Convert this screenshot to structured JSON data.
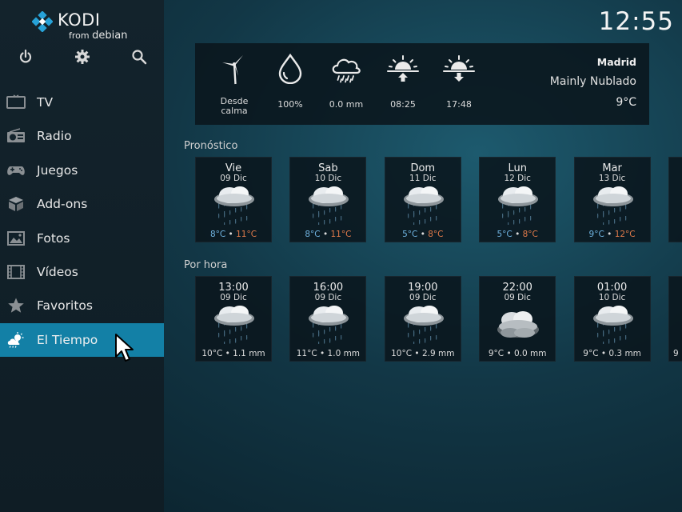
{
  "app": {
    "logo_text": "KODI",
    "logo_from": "from",
    "logo_distro": "debian"
  },
  "top_icons": [
    {
      "name": "power-icon"
    },
    {
      "name": "gear-icon"
    },
    {
      "name": "search-icon"
    }
  ],
  "sidebar": {
    "items": [
      {
        "label": "TV",
        "icon": "tv-icon"
      },
      {
        "label": "Radio",
        "icon": "radio-icon"
      },
      {
        "label": "Juegos",
        "icon": "gamepad-icon"
      },
      {
        "label": "Add-ons",
        "icon": "box-icon"
      },
      {
        "label": "Fotos",
        "icon": "photo-icon"
      },
      {
        "label": "Vídeos",
        "icon": "film-icon"
      },
      {
        "label": "Favoritos",
        "icon": "star-icon"
      },
      {
        "label": "El Tiempo",
        "icon": "weather-icon",
        "active": true
      }
    ]
  },
  "clock": "12:55",
  "current": {
    "wind_line1": "Desde",
    "wind_line2": "calma",
    "humidity": "100%",
    "precipitation": "0.0 mm",
    "sunrise": "08:25",
    "sunset": "17:48",
    "city": "Madrid",
    "condition": "Mainly Nublado",
    "temperature": "9°C"
  },
  "forecast": {
    "title": "Pronóstico",
    "days": [
      {
        "day": "Vie",
        "date": "09 Dic",
        "low": "8°C",
        "high": "11°C",
        "icon": "rain-cloud-icon"
      },
      {
        "day": "Sab",
        "date": "10 Dic",
        "low": "8°C",
        "high": "11°C",
        "icon": "rain-cloud-icon"
      },
      {
        "day": "Dom",
        "date": "11 Dic",
        "low": "5°C",
        "high": "8°C",
        "icon": "rain-cloud-icon"
      },
      {
        "day": "Lun",
        "date": "12 Dic",
        "low": "5°C",
        "high": "8°C",
        "icon": "rain-cloud-icon"
      },
      {
        "day": "Mar",
        "date": "13 Dic",
        "low": "9°C",
        "high": "12°C",
        "icon": "rain-cloud-icon"
      }
    ],
    "separator": " • "
  },
  "hourly": {
    "title": "Por hora",
    "hours": [
      {
        "time": "13:00",
        "date": "09 Dic",
        "temp": "10°C",
        "precip": "1.1 mm",
        "icon": "rain-cloud-icon"
      },
      {
        "time": "16:00",
        "date": "09 Dic",
        "temp": "11°C",
        "precip": "1.0 mm",
        "icon": "rain-cloud-icon"
      },
      {
        "time": "19:00",
        "date": "09 Dic",
        "temp": "10°C",
        "precip": "2.9 mm",
        "icon": "rain-cloud-icon"
      },
      {
        "time": "22:00",
        "date": "09 Dic",
        "temp": "9°C",
        "precip": "0.0 mm",
        "icon": "cloud-icon"
      },
      {
        "time": "01:00",
        "date": "10 Dic",
        "temp": "9°C",
        "precip": "0.3 mm",
        "icon": "rain-cloud-icon"
      }
    ],
    "partial_label": "9"
  },
  "colors": {
    "accent": "#1380a6",
    "low_temp": "#6fb3e0",
    "high_temp": "#e07a4a"
  }
}
